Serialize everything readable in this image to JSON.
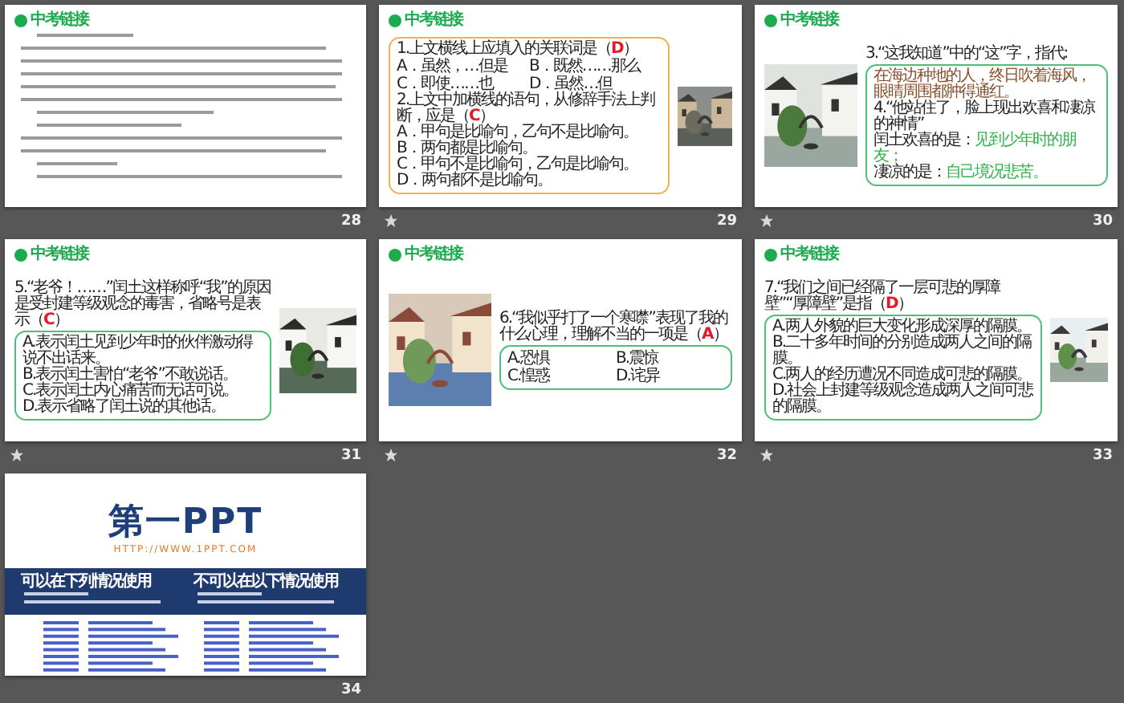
{
  "slides": [
    {
      "number": "28",
      "transition": false,
      "kind": "passage",
      "title": "中考链接"
    },
    {
      "number": "29",
      "transition": true,
      "kind": "quiz",
      "title": "中考链接",
      "parts": [
        {
          "kind": "text",
          "box": {
            "color": "#f0b24a",
            "items": [
              {
                "kind": "question",
                "text": "1.上文横线上应填入的关联词是（",
                "answer": "D",
                "end": "）"
              },
              {
                "kind": "option-pair",
                "options": [
                  "A．虽然，…但是",
                  "B．既然……那么"
                ]
              },
              {
                "kind": "option-pair",
                "options": [
                  "C．即使……也",
                  "D．虽然…但"
                ]
              },
              {
                "kind": "question",
                "text": "2.上文中加横线的语句，从修辞手法上判断，应是（",
                "answer": "C",
                "end": "）"
              },
              {
                "kind": "option",
                "text": "A．甲句是比喻句，乙句不是比喻句。"
              },
              {
                "kind": "option",
                "text": "B．两句都是比喻句。"
              },
              {
                "kind": "option",
                "text": "C．甲句不是比喻句，乙句是比喻句。"
              },
              {
                "kind": "option",
                "text": "D．两句都不是比喻句。"
              }
            ]
          }
        },
        {
          "kind": "picture"
        }
      ]
    },
    {
      "number": "30",
      "transition": true,
      "kind": "quiz",
      "title": "中考链接",
      "parts": [
        {
          "kind": "picture"
        },
        {
          "kind": "text",
          "intro": [
            {
              "kind": "question",
              "text": "3.“这我知道”中的“这”字，指代:"
            }
          ],
          "box": {
            "color": "#4cc07a",
            "items": [
              {
                "kind": "quote",
                "text": "在海边种地的人，终日吹着海风，眼睛周围都肿得通红。"
              },
              {
                "kind": "question",
                "text": "4.“他站住了，脸上现出欢喜和凄凉的神情”"
              },
              {
                "kind": "finding",
                "text": "闰土欢喜的是：",
                "answer": "见到少年时的朋友；"
              },
              {
                "kind": "finding",
                "text": "凄凉的是：",
                "answer": "自己境况悲苦。"
              }
            ]
          }
        }
      ]
    },
    {
      "number": "31",
      "transition": true,
      "kind": "quiz",
      "title": "中考链接",
      "parts": [
        {
          "kind": "text",
          "intro": [
            {
              "kind": "question",
              "text": "5.“老爷！……”闰土这样称呼“我”的原因是受封建等级观念的毒害，省略号是表示（",
              "answer": "C",
              "end": "）"
            }
          ],
          "box": {
            "color": "#4cc07a",
            "items": [
              {
                "kind": "option",
                "text": "A.表示闰土见到少年时的伙伴激动得说不出话来。"
              },
              {
                "kind": "option",
                "text": "B.表示闰土害怕“老爷”不敢说话。"
              },
              {
                "kind": "option",
                "text": "C.表示闰土内心痛苦而无话可说。"
              },
              {
                "kind": "option",
                "text": "D.表示省略了闰土说的其他话。"
              }
            ]
          }
        },
        {
          "kind": "picture"
        }
      ]
    },
    {
      "number": "32",
      "transition": true,
      "kind": "quiz",
      "title": "中考链接",
      "parts": [
        {
          "kind": "picture"
        },
        {
          "kind": "text",
          "intro": [
            {
              "kind": "question",
              "text": "6.“我似乎打了一个寒噤”表现了我的什么心理，理解不当的一项是（",
              "answer": "A",
              "end": "）"
            }
          ],
          "box": {
            "color": "#4cc07a",
            "items": [
              {
                "kind": "option-pair",
                "options": [
                  "A.恐惧",
                  "B.震惊"
                ]
              },
              {
                "kind": "option-pair",
                "options": [
                  "C.惶惑",
                  "D.诧异"
                ]
              }
            ]
          }
        }
      ]
    },
    {
      "number": "33",
      "transition": true,
      "kind": "quiz",
      "title": "中考链接",
      "parts": [
        {
          "kind": "text",
          "intro": [
            {
              "kind": "question",
              "text": "7.“我们之间已经隔了一层可悲的厚障壁”“厚障壁”是指（",
              "answer": "D",
              "end": "）"
            }
          ],
          "box": {
            "color": "#4cc07a",
            "items": [
              {
                "kind": "option",
                "text": "A.两人外貌的巨大变化形成深厚的隔膜。"
              },
              {
                "kind": "option",
                "text": "B.二十多年时间的分别造成两人之间的隔膜。"
              },
              {
                "kind": "option",
                "text": "C.两人的经历遭况不同造成可悲的隔膜。"
              },
              {
                "kind": "option",
                "text": "D.社会上封建等级观念造成两人之间可悲的隔膜。"
              }
            ]
          }
        },
        {
          "kind": "picture"
        }
      ]
    },
    {
      "number": "34",
      "transition": false,
      "kind": "credits",
      "logo": "第一PPT",
      "url": "HTTP://WWW.1PPT.COM",
      "columns": [
        {
          "heading": "可以在下列情况使用"
        },
        {
          "heading": "不可以在以下情况使用"
        }
      ]
    }
  ]
}
